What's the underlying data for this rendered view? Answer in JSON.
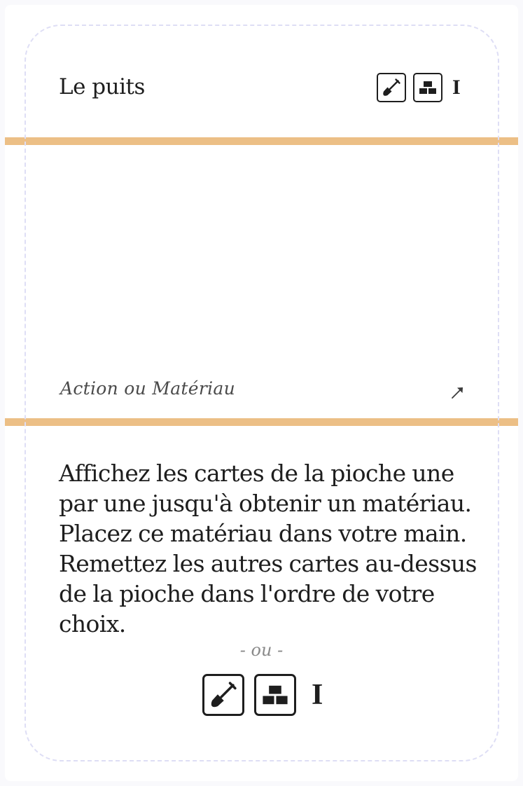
{
  "card": {
    "title": "Le puits",
    "cost": {
      "icons": [
        "shovel-icon",
        "bricks-icon"
      ],
      "level": "I"
    },
    "type_label": "Action ou Matériau",
    "corner_icon": "arrow-up-right-icon",
    "description": "Affichez les cartes de la pioche une par une jusqu'à obtenir un matériau. Placez ce matériau dans votre main. Remettez les autres cartes au-dessus de la pioche dans l'ordre de votre choix.",
    "separator": "- ou -",
    "alternative": {
      "icons": [
        "shovel-icon",
        "bricks-icon"
      ],
      "level": "I"
    }
  },
  "colors": {
    "band": "#ecbf86",
    "ink": "#1e1e1e",
    "safe_zone_border": "#dedef5",
    "muted_text": "#8a8a8a"
  }
}
